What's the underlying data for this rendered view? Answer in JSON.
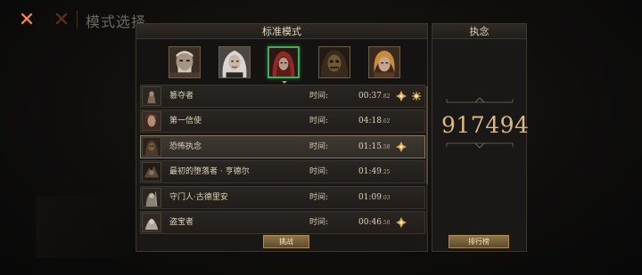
{
  "top": {
    "title": "模式选择"
  },
  "main": {
    "header": "标准模式",
    "portraits": [
      {
        "name": "old-man",
        "selected": false
      },
      {
        "name": "white-hair-woman",
        "selected": false
      },
      {
        "name": "red-hood",
        "selected": true
      },
      {
        "name": "masked-figure",
        "selected": false
      },
      {
        "name": "blonde-man",
        "selected": false
      }
    ],
    "rows": [
      {
        "name": "篡夺者",
        "time_label": "时间:",
        "time": "00:37",
        "ms": ".82",
        "medals": 2,
        "selected": false
      },
      {
        "name": "第一信使",
        "time_label": "时间:",
        "time": "04:18",
        "ms": ".62",
        "medals": 0,
        "selected": false
      },
      {
        "name": "恐怖执念",
        "time_label": "时间:",
        "time": "01:15",
        "ms": ".58",
        "medals": 1,
        "selected": true
      },
      {
        "name": "最初的堕落者 · 亨德尔",
        "time_label": "时间:",
        "time": "01:49",
        "ms": ".25",
        "medals": 0,
        "selected": false
      },
      {
        "name": "守门人·古德里安",
        "time_label": "时间:",
        "time": "01:09",
        "ms": ".03",
        "medals": 0,
        "selected": false
      },
      {
        "name": "盗宝者",
        "time_label": "时间:",
        "time": "00:46",
        "ms": ".50",
        "medals": 1,
        "selected": false
      }
    ],
    "challenge_label": "挑战"
  },
  "side": {
    "header": "执念",
    "score": "917494",
    "leaderboard_label": "排行榜"
  },
  "colors": {
    "accent_gold": "#b89a5a",
    "selected_green": "#3fae5b",
    "close_orange": "#e0662a"
  }
}
